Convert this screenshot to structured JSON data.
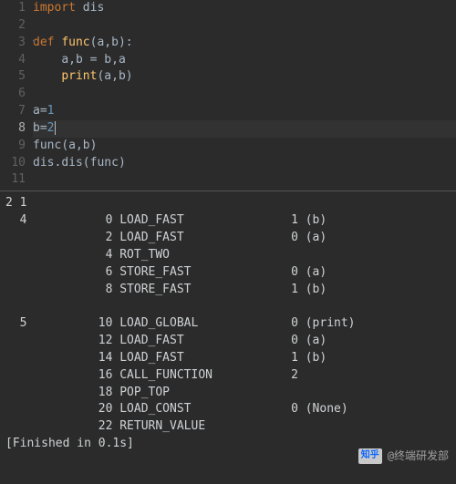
{
  "code": {
    "lines": [
      {
        "n": "1",
        "arrow": false,
        "active": false,
        "html": "<span class='kw'>import</span> <span class='id'>dis</span>"
      },
      {
        "n": "2",
        "arrow": false,
        "active": false,
        "html": ""
      },
      {
        "n": "3",
        "arrow": true,
        "active": false,
        "html": "<span class='kw'>def</span> <span class='fn'>func</span><span class='op'>(</span><span class='id'>a</span><span class='op'>,</span><span class='id'>b</span><span class='op'>):</span>"
      },
      {
        "n": "4",
        "arrow": false,
        "active": false,
        "html": "    <span class='id'>a</span><span class='op'>,</span><span class='id'>b</span> <span class='op'>=</span> <span class='id'>b</span><span class='op'>,</span><span class='id'>a</span>"
      },
      {
        "n": "5",
        "arrow": false,
        "active": false,
        "html": "    <span class='pr'>print</span><span class='op'>(</span><span class='id'>a</span><span class='op'>,</span><span class='id'>b</span><span class='op'>)</span>"
      },
      {
        "n": "6",
        "arrow": false,
        "active": false,
        "html": ""
      },
      {
        "n": "7",
        "arrow": false,
        "active": false,
        "html": "<span class='id'>a</span><span class='op'>=</span><span class='num'>1</span>"
      },
      {
        "n": "8",
        "arrow": false,
        "active": true,
        "html": "<span class='id'>b</span><span class='op'>=</span><span class='num'>2</span><span class='caret'></span>"
      },
      {
        "n": "9",
        "arrow": false,
        "active": false,
        "html": "<span class='id'>func</span><span class='op'>(</span><span class='id'>a</span><span class='op'>,</span><span class='id'>b</span><span class='op'>)</span>"
      },
      {
        "n": "10",
        "arrow": false,
        "active": false,
        "html": "<span class='id'>dis</span><span class='op'>.</span><span class='id'>dis</span><span class='op'>(</span><span class='id'>func</span><span class='op'>)</span>"
      },
      {
        "n": "11",
        "arrow": false,
        "active": false,
        "html": ""
      }
    ]
  },
  "output": {
    "header": "2 1",
    "rows": [
      {
        "src": "4",
        "off": "0",
        "op": "LOAD_FAST",
        "arg": "1",
        "argn": "(b)"
      },
      {
        "src": "",
        "off": "2",
        "op": "LOAD_FAST",
        "arg": "0",
        "argn": "(a)"
      },
      {
        "src": "",
        "off": "4",
        "op": "ROT_TWO",
        "arg": "",
        "argn": ""
      },
      {
        "src": "",
        "off": "6",
        "op": "STORE_FAST",
        "arg": "0",
        "argn": "(a)"
      },
      {
        "src": "",
        "off": "8",
        "op": "STORE_FAST",
        "arg": "1",
        "argn": "(b)"
      },
      {
        "src": "BLANK",
        "off": "",
        "op": "",
        "arg": "",
        "argn": ""
      },
      {
        "src": "5",
        "off": "10",
        "op": "LOAD_GLOBAL",
        "arg": "0",
        "argn": "(print)"
      },
      {
        "src": "",
        "off": "12",
        "op": "LOAD_FAST",
        "arg": "0",
        "argn": "(a)"
      },
      {
        "src": "",
        "off": "14",
        "op": "LOAD_FAST",
        "arg": "1",
        "argn": "(b)"
      },
      {
        "src": "",
        "off": "16",
        "op": "CALL_FUNCTION",
        "arg": "2",
        "argn": ""
      },
      {
        "src": "",
        "off": "18",
        "op": "POP_TOP",
        "arg": "",
        "argn": ""
      },
      {
        "src": "",
        "off": "20",
        "op": "LOAD_CONST",
        "arg": "0",
        "argn": "(None)"
      },
      {
        "src": "",
        "off": "22",
        "op": "RETURN_VALUE",
        "arg": "",
        "argn": ""
      }
    ],
    "footer": "[Finished in 0.1s]"
  },
  "watermark": {
    "logo": "知乎",
    "text": "@终端研发部"
  }
}
